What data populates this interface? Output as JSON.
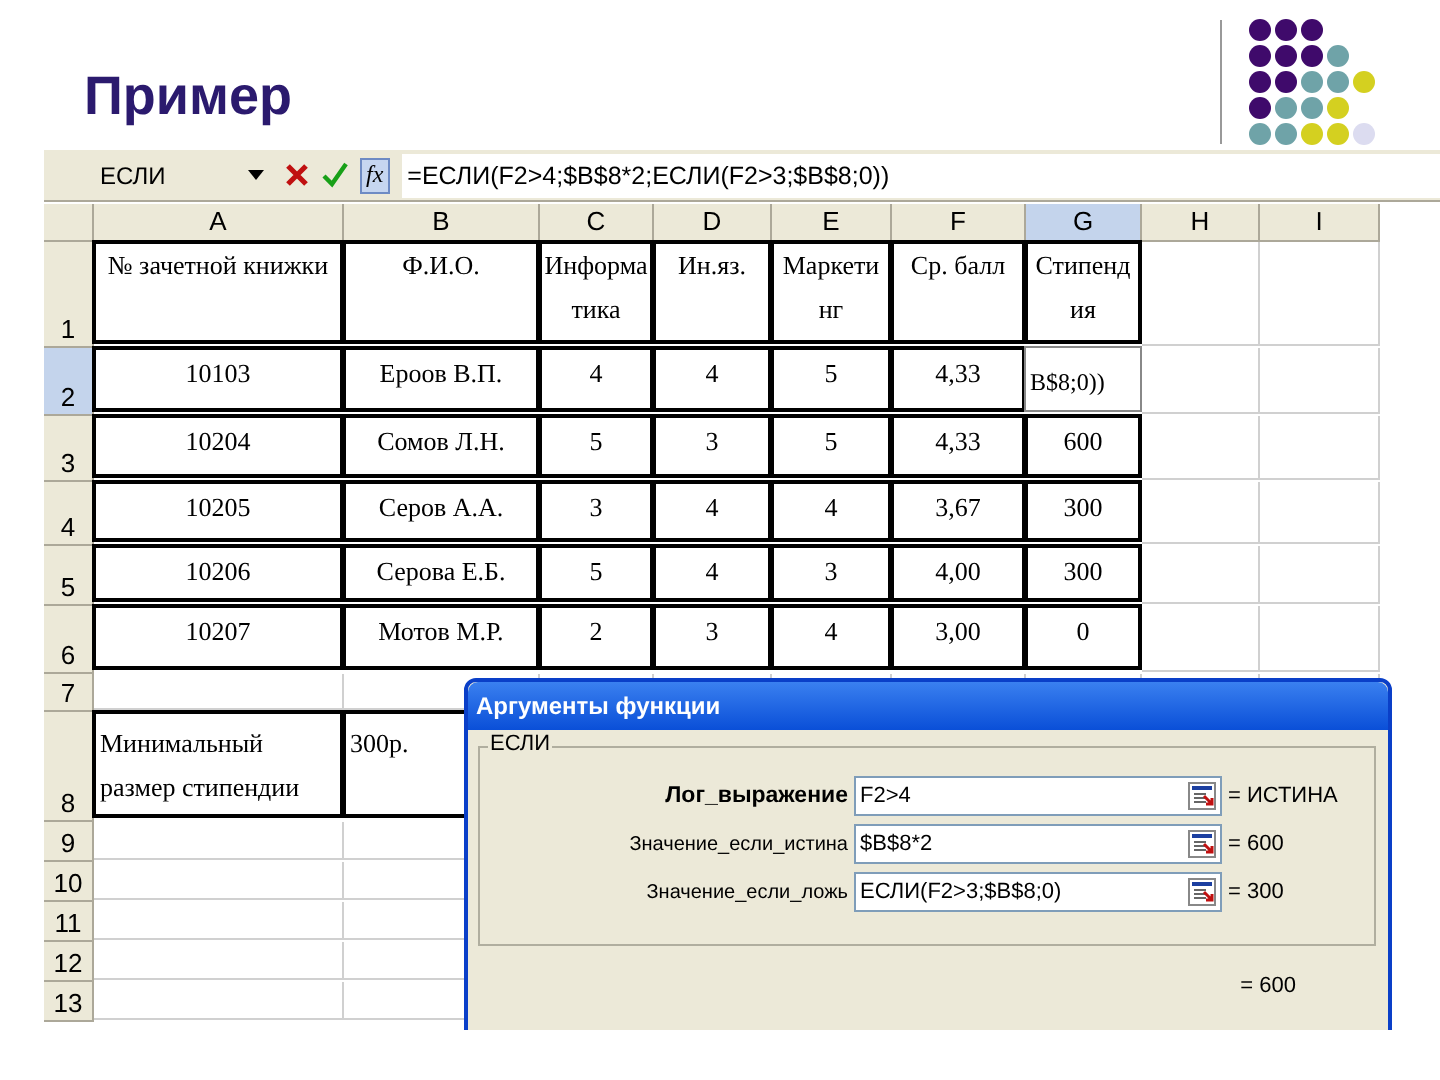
{
  "slide": {
    "title": "Пример"
  },
  "formula_bar": {
    "name_box": "ЕСЛИ",
    "fx": "fx",
    "formula": "=ЕСЛИ(F2>4;$B$8*2;ЕСЛИ(F2>3;$B$8;0))"
  },
  "columns": [
    {
      "label": "A",
      "selected": false
    },
    {
      "label": "B",
      "selected": false
    },
    {
      "label": "C",
      "selected": false
    },
    {
      "label": "D",
      "selected": false
    },
    {
      "label": "E",
      "selected": false
    },
    {
      "label": "F",
      "selected": false
    },
    {
      "label": "G",
      "selected": true
    },
    {
      "label": "H",
      "selected": false
    },
    {
      "label": "I",
      "selected": false
    }
  ],
  "rows": [
    {
      "number": "1",
      "selected": false,
      "cells": [
        "№ зачетной книжки",
        "Ф.И.О.",
        "Информатика",
        "Ин.яз.",
        "Маркетинг",
        "Ср. балл",
        "Стипендия"
      ]
    },
    {
      "number": "2",
      "selected": true,
      "cells": [
        "10103",
        "Ероов В.П.",
        "4",
        "4",
        "5",
        "4,33",
        "B$8;0))"
      ]
    },
    {
      "number": "3",
      "selected": false,
      "cells": [
        "10204",
        "Сомов Л.Н.",
        "5",
        "3",
        "5",
        "4,33",
        "600"
      ]
    },
    {
      "number": "4",
      "selected": false,
      "cells": [
        "10205",
        "Серов А.А.",
        "3",
        "4",
        "4",
        "3,67",
        "300"
      ]
    },
    {
      "number": "5",
      "selected": false,
      "cells": [
        "10206",
        "Серова Е.Б.",
        "5",
        "4",
        "3",
        "4,00",
        "300"
      ]
    },
    {
      "number": "6",
      "selected": false,
      "cells": [
        "10207",
        "Мотов М.Р.",
        "2",
        "3",
        "4",
        "3,00",
        "0"
      ]
    },
    {
      "number": "7",
      "selected": false,
      "cells": []
    },
    {
      "number": "8",
      "selected": false,
      "cells": [
        "Минимальный размер стипендии",
        "300р."
      ]
    },
    {
      "number": "9",
      "selected": false,
      "cells": []
    },
    {
      "number": "10",
      "selected": false,
      "cells": []
    },
    {
      "number": "11",
      "selected": false,
      "cells": []
    },
    {
      "number": "12",
      "selected": false,
      "cells": []
    },
    {
      "number": "13",
      "selected": false,
      "cells": []
    }
  ],
  "dialog": {
    "title": "Аргументы функции",
    "group": "ЕСЛИ",
    "arguments": [
      {
        "label": "Лог_выражение",
        "required": true,
        "value": "F2>4",
        "result": "= ИСТИНА"
      },
      {
        "label": "Значение_если_истина",
        "required": false,
        "value": "$B$8*2",
        "result": "= 600"
      },
      {
        "label": "Значение_если_ложь",
        "required": false,
        "value": "ЕСЛИ(F2>3;$B$8;0)",
        "result": "= 300"
      }
    ],
    "total": "= 600"
  }
}
